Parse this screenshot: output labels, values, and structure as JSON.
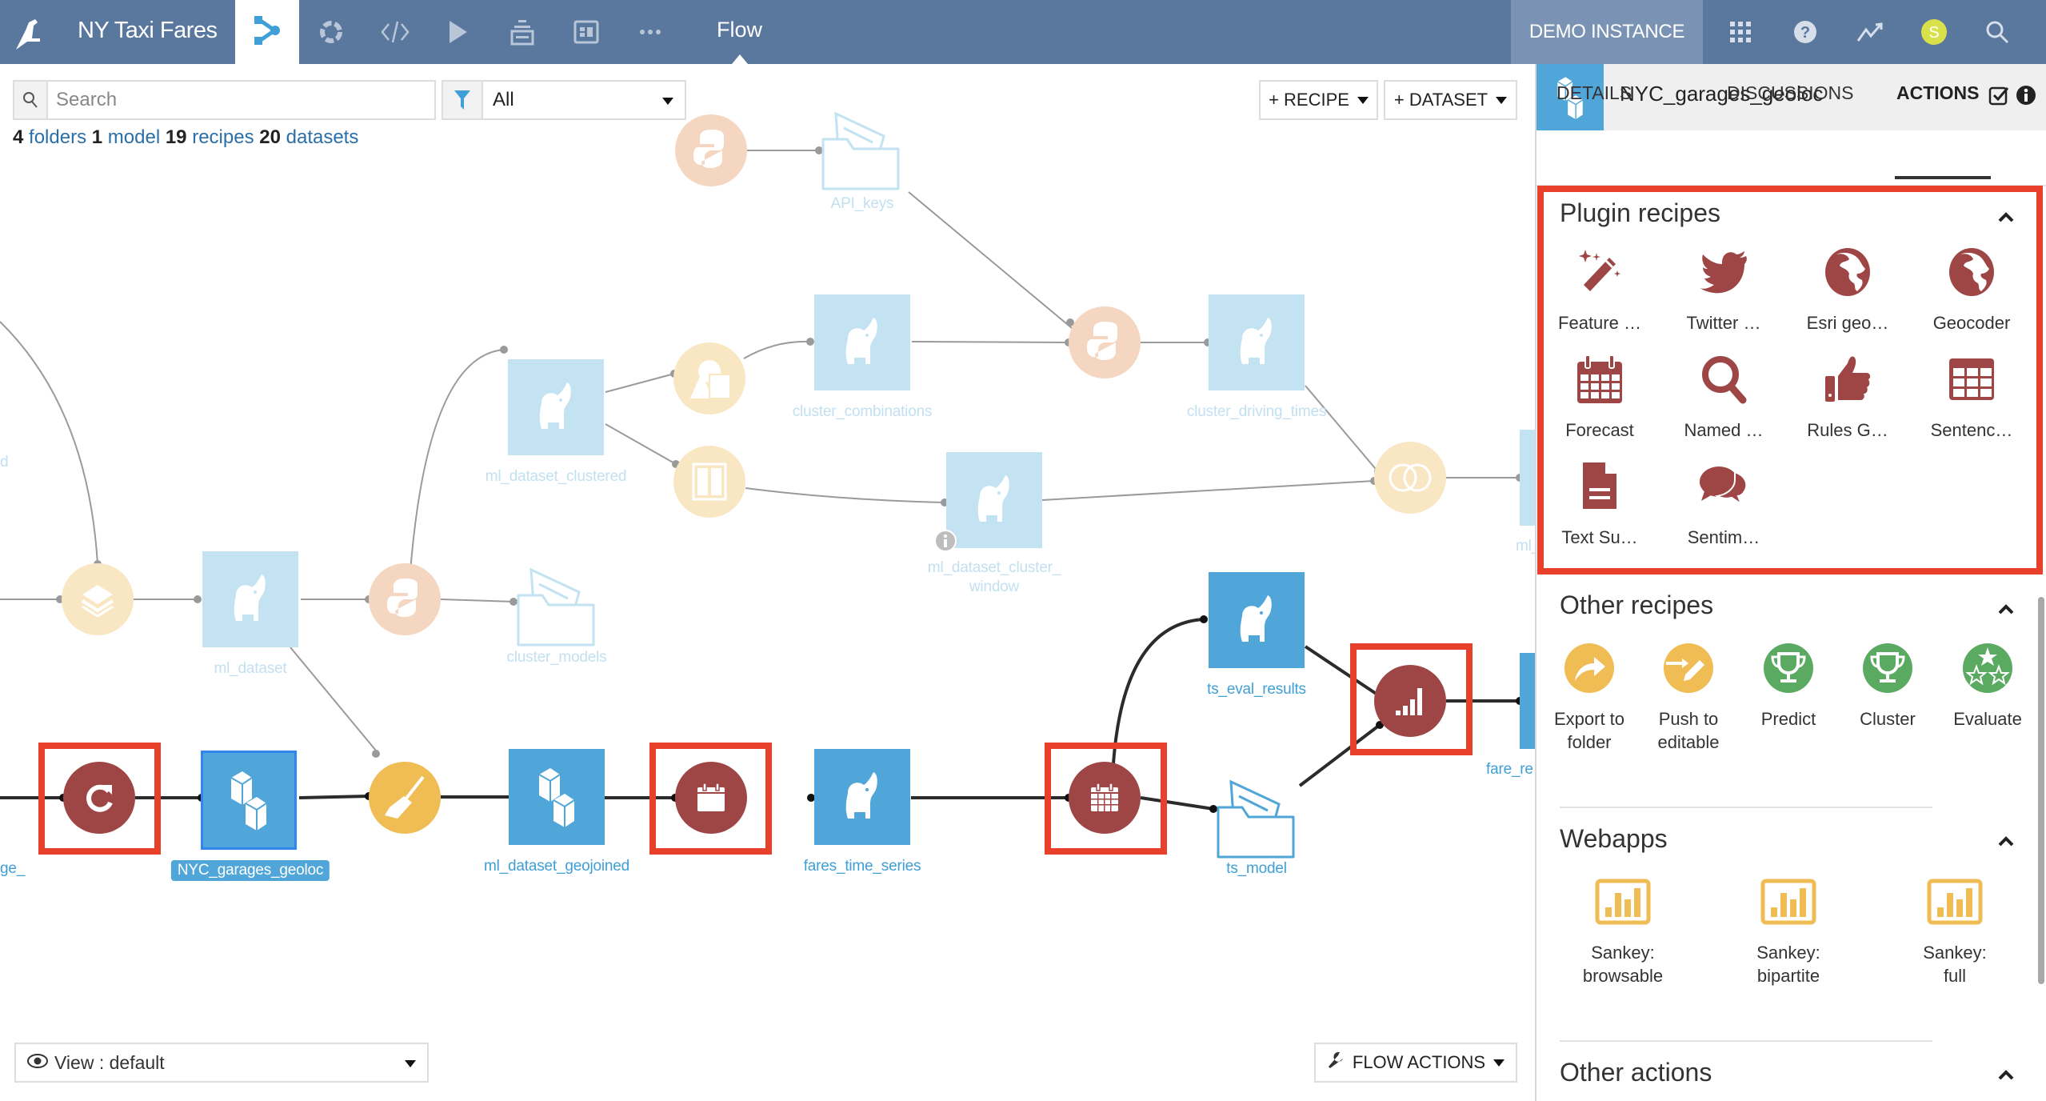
{
  "header": {
    "project_title": "NY Taxi Fares",
    "breadcrumb": "Flow",
    "instance_label": "DEMO INSTANCE",
    "avatar_initial": "S",
    "nav_icons": [
      "flow-icon",
      "lab-icon",
      "code-icon",
      "run-icon",
      "datasets-icon",
      "dashboard-icon",
      "more-icon"
    ],
    "right_icons": [
      "apps-grid-icon",
      "help-icon",
      "activity-icon",
      "avatar",
      "search-icon"
    ],
    "colors": {
      "bar": "#5a779e",
      "instance": "#7a93b4",
      "avatar": "#d8e04a"
    }
  },
  "toolbar": {
    "search_placeholder": "Search",
    "filter_value": "All",
    "recipe_button": "+ RECIPE",
    "dataset_button": "+ DATASET",
    "counts": {
      "folders_n": "4",
      "folders_label": "folders",
      "models_n": "1",
      "models_label": "model",
      "recipes_n": "19",
      "recipes_label": "recipes",
      "datasets_n": "20",
      "datasets_label": "datasets"
    }
  },
  "flow": {
    "labels": {
      "api_keys": "API_keys",
      "cluster_combinations": "cluster_combinations",
      "cluster_driving_times": "cluster_driving_times",
      "ml_dataset_clustered": "ml_dataset_clustered",
      "ml_dataset_cluster_window": "ml_dataset_cluster_\nwindow",
      "ml_dataset_cluster_window_l1": "ml_dataset_cluster_",
      "ml_dataset_cluster_window_l2": "window",
      "ml_da_partial": "ml_da",
      "ml_dataset": "ml_dataset",
      "cluster_models": "cluster_models",
      "left_partial_top": "d",
      "left_partial_bottom": "ge_",
      "nyc_garages_geoloc": "NYC_garages_geoloc",
      "ml_dataset_geojoined": "ml_dataset_geojoined",
      "fares_time_series": "fares_time_series",
      "ts_eval_results": "ts_eval_results",
      "ts_model": "ts_model",
      "fare_re_partial": "fare_re"
    },
    "colors": {
      "dataset": "#51a6d9",
      "dataset_faded": "#c3e2f2",
      "python_faded": "#f5d6c0",
      "visual_faded": "#f9e7c4",
      "prepare": "#f0bd55",
      "plugin": "#9e4646",
      "highlight": "#e8402a"
    }
  },
  "bottom": {
    "view_label": "View : default",
    "flow_actions": "FLOW ACTIONS"
  },
  "panel": {
    "object_name": "NYC_garages_geoloc",
    "tabs": [
      "DETAILS",
      "DISCUSSIONS",
      "ACTIONS"
    ],
    "active_tab": "ACTIONS",
    "plugin_recipes": {
      "title": "Plugin recipes",
      "items": [
        {
          "label": "Feature …",
          "icon": "magic-wand-icon"
        },
        {
          "label": "Twitter …",
          "icon": "twitter-icon"
        },
        {
          "label": "Esri geo…",
          "icon": "globe-icon"
        },
        {
          "label": "Geocoder",
          "icon": "globe-icon"
        },
        {
          "label": "Forecast",
          "icon": "calendar-icon"
        },
        {
          "label": "Named …",
          "icon": "magnifier-icon"
        },
        {
          "label": "Rules G…",
          "icon": "thumbs-up-icon"
        },
        {
          "label": "Sentenc…",
          "icon": "table-icon"
        },
        {
          "label": "Text Su…",
          "icon": "document-icon"
        },
        {
          "label": "Sentim…",
          "icon": "chat-bubbles-icon"
        }
      ]
    },
    "other_recipes": {
      "title": "Other recipes",
      "items": [
        {
          "label1": "Export to",
          "label2": "folder",
          "icon": "share-arrow-icon"
        },
        {
          "label1": "Push to",
          "label2": "editable",
          "icon": "push-edit-icon"
        },
        {
          "label1": "Predict",
          "label2": "",
          "icon": "trophy-icon"
        },
        {
          "label1": "Cluster",
          "label2": "",
          "icon": "trophy-icon"
        },
        {
          "label1": "Evaluate",
          "label2": "",
          "icon": "stars-icon"
        }
      ]
    },
    "webapps": {
      "title": "Webapps",
      "items": [
        {
          "label1": "Sankey:",
          "label2": "browsable"
        },
        {
          "label1": "Sankey:",
          "label2": "bipartite"
        },
        {
          "label1": "Sankey:",
          "label2": "full"
        }
      ]
    },
    "other_actions": {
      "title": "Other actions"
    }
  }
}
